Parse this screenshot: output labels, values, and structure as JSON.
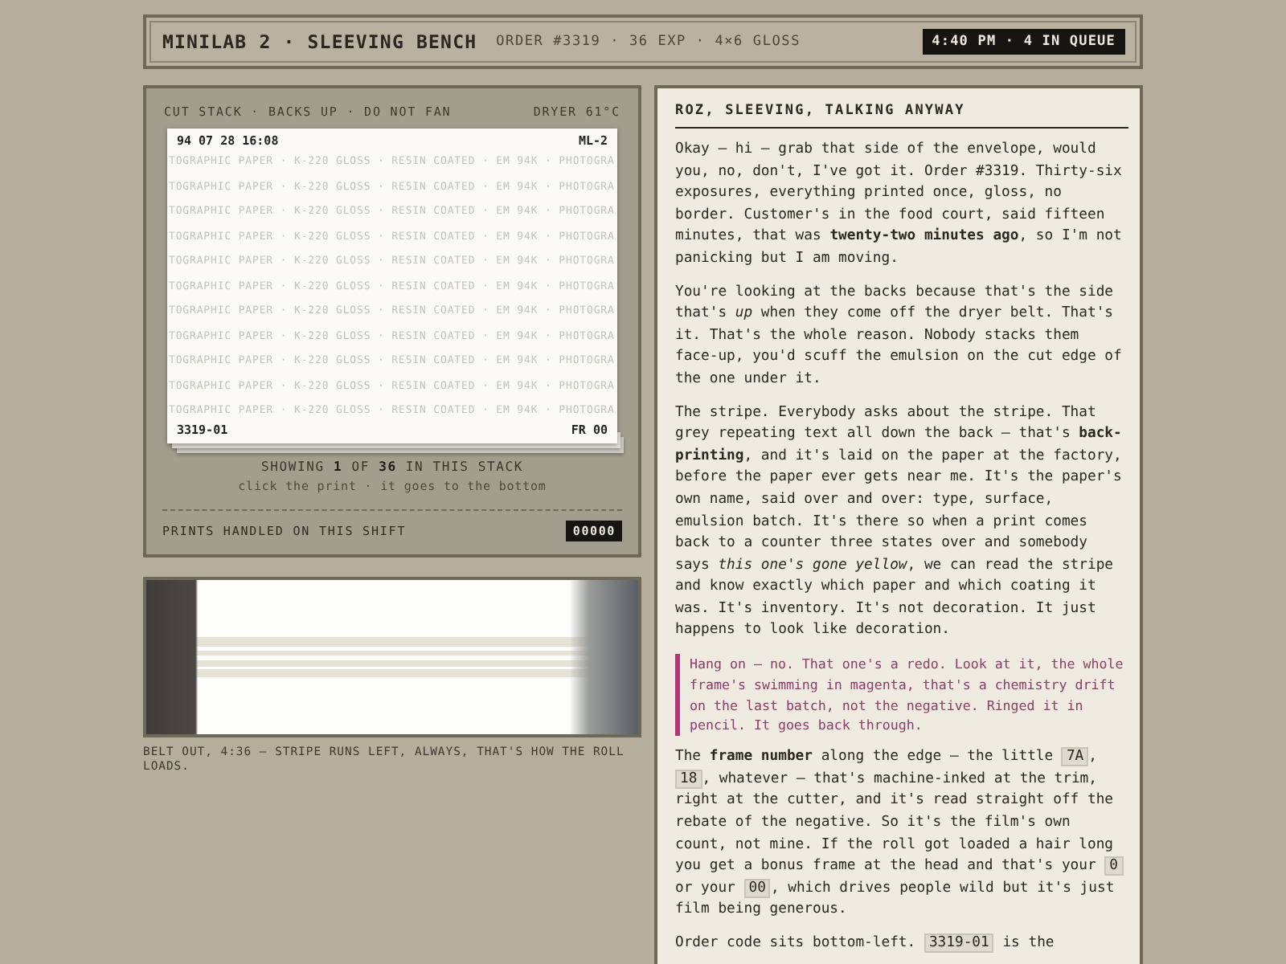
{
  "header": {
    "title": "MINILAB 2 · SLEEVING BENCH",
    "meta": "ORDER #3319 · 36 EXP · 4×6 GLOSS",
    "clock": "4:40 PM · 4 IN QUEUE"
  },
  "stack": {
    "label": "CUT STACK · BACKS UP · DO NOT FAN",
    "dryer": "DRYER 61°C",
    "print": {
      "stamp": "94 07 28 16:08",
      "machine": "ML-2",
      "order_code": "3319-01",
      "frame": "FR 00",
      "backprint": [
        "TOGRAPHIC PAPER · K-220 GLOSS · RESIN COATED · EM 94K · PHOTOGRA",
        "TOGRAPHIC PAPER · K-220 GLOSS · RESIN COATED · EM 94K · PHOTOGRA",
        "TOGRAPHIC PAPER · K-220 GLOSS · RESIN COATED · EM 94K · PHOTOGRA",
        "TOGRAPHIC PAPER · K-220 GLOSS · RESIN COATED · EM 94K · PHOTOGRA",
        "TOGRAPHIC PAPER · K-220 GLOSS · RESIN COATED · EM 94K · PHOTOGRA",
        "TOGRAPHIC PAPER · K-220 GLOSS · RESIN COATED · EM 94K · PHOTOGRA",
        "TOGRAPHIC PAPER · K-220 GLOSS · RESIN COATED · EM 94K · PHOTOGRA",
        "TOGRAPHIC PAPER · K-220 GLOSS · RESIN COATED · EM 94K · PHOTOGRA",
        "TOGRAPHIC PAPER · K-220 GLOSS · RESIN COATED · EM 94K · PHOTOGRA",
        "TOGRAPHIC PAPER · K-220 GLOSS · RESIN COATED · EM 94K · PHOTOGRA",
        "TOGRAPHIC PAPER · K-220 GLOSS · RESIN COATED · EM 94K · PHOTOGRA"
      ]
    },
    "showing": "SHOWING **1** OF **36** IN THIS STACK",
    "hint": "click the print · it goes to the bottom",
    "handled_label": "PRINTS HANDLED ON THIS SHIFT",
    "handled_count": "00000"
  },
  "photo": {
    "caption": "BELT OUT, 4:36 — STRIPE RUNS LEFT, ALWAYS, THAT'S HOW THE ROLL LOADS."
  },
  "talk": {
    "title": "ROZ, SLEEVING, TALKING ANYWAY",
    "paragraphs": [
      {
        "kind": "prose",
        "parts": [
          {
            "kind": "text",
            "text": "Okay — hi — grab that side of the envelope, would you, no, don't, I've got it. Order #3319. Thirty-six exposures, everything printed once, gloss, no border. Customer's in the food court, said fifteen minutes, that was **twenty-two minutes ago**, so I'm not panicking but I am moving."
          }
        ]
      },
      {
        "kind": "prose",
        "parts": [
          {
            "kind": "text",
            "text": "You're looking at the backs because that's the side that's *up* when they come off the dryer belt. That's it. That's the whole reason. Nobody stacks them face-up, you'd scuff the emulsion on the cut edge of the one under it."
          }
        ]
      },
      {
        "kind": "prose",
        "parts": [
          {
            "kind": "text",
            "text": "The stripe. Everybody asks about the stripe. That grey repeating text all down the back — that's **back-printing**, and it's laid on the paper at the factory, before the paper ever gets near me. It's the paper's own name, said over and over: type, surface, emulsion batch. It's there so when a print comes back to a counter three states over and somebody says *this one's gone yellow*, we can read the stripe and know exactly which paper and which coating it was. It's inventory. It's not decoration. It just happens to look like decoration."
          }
        ]
      },
      {
        "kind": "aside",
        "parts": [
          {
            "kind": "text",
            "text": "Hang on — no. That one's a redo. Look at it, the whole frame's swimming in magenta, that's a chemistry drift on the last batch, not the negative. Ringed it in pencil. It goes back through."
          }
        ]
      },
      {
        "kind": "prose",
        "parts": [
          {
            "kind": "text",
            "text": "The **frame number** along the edge — the little "
          },
          {
            "kind": "code",
            "text": "7A"
          },
          {
            "kind": "text",
            "text": ", "
          },
          {
            "kind": "code",
            "text": "18"
          },
          {
            "kind": "text",
            "text": ", whatever — that's machine-inked at the trim, right at the cutter, and it's read straight off the rebate of the negative. So it's the film's own count, not mine. If the roll got loaded a hair long you get a bonus frame at the head and that's your "
          },
          {
            "kind": "code",
            "text": "0"
          },
          {
            "kind": "text",
            "text": " or your "
          },
          {
            "kind": "code",
            "text": "00"
          },
          {
            "kind": "text",
            "text": ", which drives people wild but it's just film being generous."
          }
        ]
      },
      {
        "kind": "prose",
        "parts": [
          {
            "kind": "text",
            "text": "Order code sits bottom-left. "
          },
          {
            "kind": "code",
            "text": "3319-01"
          },
          {
            "kind": "text",
            "text": " is the"
          }
        ]
      }
    ]
  }
}
